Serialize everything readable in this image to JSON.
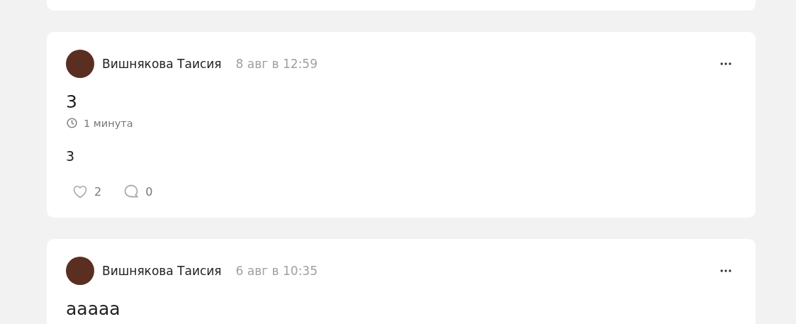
{
  "posts": [
    {
      "author": "Вишнякова Таисия",
      "date": "8 авг в 12:59",
      "title": "3",
      "read_time": "1 минута",
      "body": "3",
      "liked": false,
      "likes": "2",
      "comments": "0"
    },
    {
      "author": "Вишнякова Таисия",
      "date": "6 авг в 10:35",
      "title": "ааааа"
    }
  ]
}
